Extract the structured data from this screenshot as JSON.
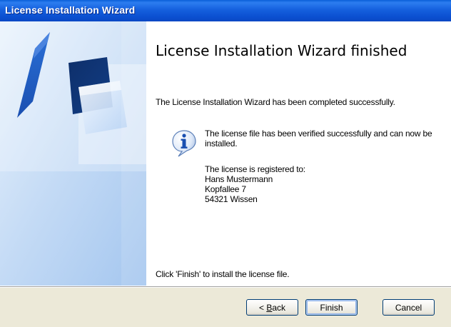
{
  "window": {
    "title": "License Installation Wizard"
  },
  "content": {
    "heading": "License Installation Wizard finished",
    "intro": "The License Installation Wizard has been completed successfully.",
    "message": "The license file has been verified successfully and can now be installed.",
    "registered_label": "The license is registered to:",
    "registered_name": "Hans Mustermann",
    "registered_street": "Kopfallee 7",
    "registered_city": "54321 Wissen",
    "footer": "Click 'Finish' to install the license file.",
    "info_icon": "info-icon"
  },
  "buttons": {
    "back_prefix": "< ",
    "back_mnemonic": "B",
    "back_rest": "ack",
    "finish": "Finish",
    "cancel": "Cancel"
  },
  "colors": {
    "titlebar": "#0a5fd8",
    "sidepanel": "#b7d3f2",
    "buttonbar": "#ece9d8",
    "button_border": "#003c74"
  }
}
